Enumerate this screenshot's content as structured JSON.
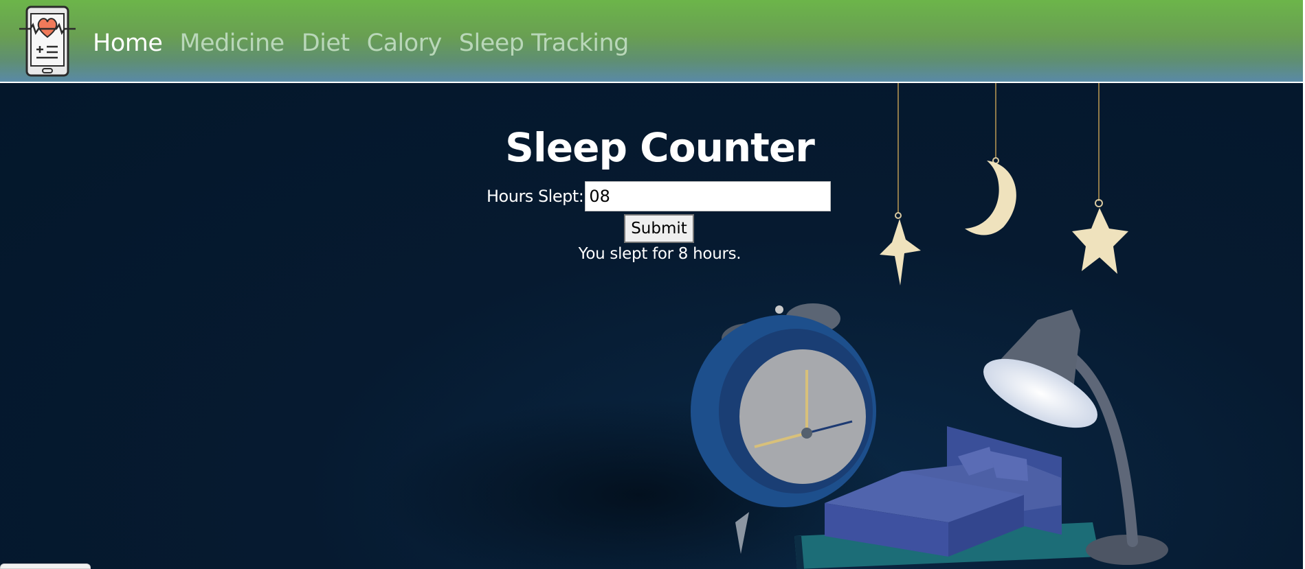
{
  "nav": {
    "logo_icon": "health-phone-heart-icon",
    "links": [
      {
        "label": "Home",
        "active": true
      },
      {
        "label": "Medicine",
        "active": false
      },
      {
        "label": "Diet",
        "active": false
      },
      {
        "label": "Calory",
        "active": false
      },
      {
        "label": "Sleep Tracking",
        "active": false
      }
    ]
  },
  "main": {
    "title": "Sleep Counter",
    "form": {
      "label": "Hours Slept:",
      "input_value": "08",
      "submit_label": "Submit"
    },
    "result": "You slept for 8 hours."
  },
  "colors": {
    "nav_top": "#6cb54a",
    "nav_bottom": "#5a8aa3",
    "background": "#04172b",
    "nav_inactive_text": "#b9d7b9",
    "nav_active_text": "#ffffff"
  },
  "illustration_icons": [
    "hanging-star-icon",
    "hanging-moon-icon",
    "alarm-clock-icon",
    "bed-icon",
    "desk-lamp-icon",
    "book-stack-icon"
  ]
}
